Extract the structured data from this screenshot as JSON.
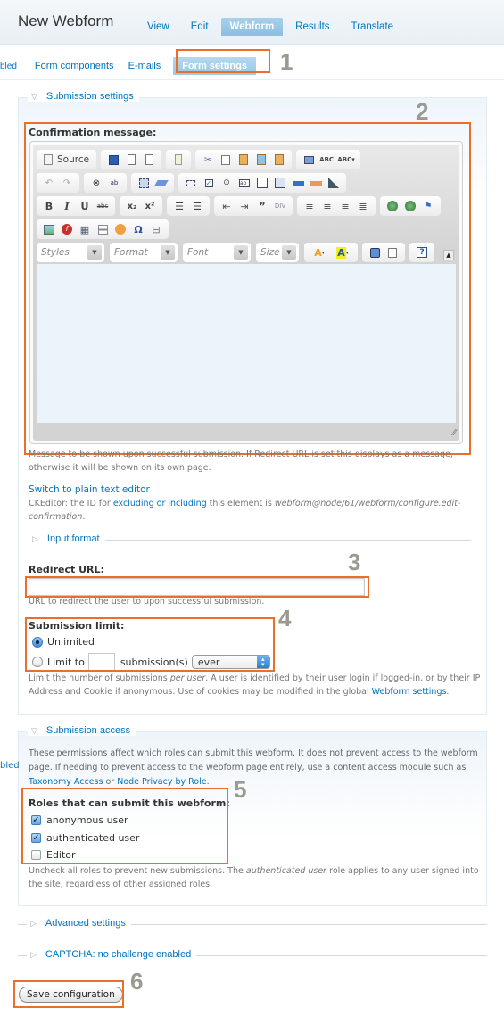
{
  "header": {
    "title": "New Webform",
    "tabs": [
      {
        "label": "View",
        "active": false
      },
      {
        "label": "Edit",
        "active": false
      },
      {
        "label": "Webform",
        "active": true
      },
      {
        "label": "Results",
        "active": false
      },
      {
        "label": "Translate",
        "active": false
      }
    ]
  },
  "subtabs": {
    "cut_label": "bled",
    "items": [
      {
        "label": "Form components",
        "active": false
      },
      {
        "label": "E-mails",
        "active": false
      },
      {
        "label": "Form settings",
        "active": true
      }
    ]
  },
  "callouts": [
    "1",
    "2",
    "3",
    "4",
    "5",
    "6"
  ],
  "submission_settings": {
    "legend": "Submission settings",
    "confirmation": {
      "label": "Confirmation message:",
      "toolbar": {
        "source_label": "Source",
        "combos": [
          "Styles",
          "Format",
          "Font",
          "Size"
        ]
      },
      "description": "Message to be shown upon successful submission. If Redirect URL is set this displays as a message, otherwise it will be shown on its own page.",
      "switch_link": "Switch to plain text editor",
      "cke_note_prefix": "CKEditor: the ID for",
      "cke_note_link": "excluding or including",
      "cke_note_middle": "this element is",
      "cke_note_id": "webform@node/61/webform/configure.edit-confirmation",
      "cke_note_end": "."
    },
    "input_format_legend": "Input format",
    "redirect": {
      "label": "Redirect URL:",
      "value": "",
      "description": "URL to redirect the user to upon successful submission."
    },
    "limit": {
      "label": "Submission limit:",
      "options": [
        {
          "label": "Unlimited",
          "selected": true
        },
        {
          "label": "Limit to",
          "selected": false
        }
      ],
      "count_value": "",
      "unit_label": "submission(s)",
      "period_value": "ever",
      "desc_1": "Limit the number of submissions",
      "desc_em": "per user",
      "desc_2": ". A user is identified by their user login if logged-in, or by their IP Address and Cookie if anonymous. Use of cookies may be modified in the global",
      "desc_link": "Webform settings",
      "desc_end": "."
    }
  },
  "submission_access": {
    "legend": "Submission access",
    "desc_1": "These permissions affect which roles can submit this webform. It does not prevent access to the webform page. If needing to prevent access to the webform page entirely, use a content access module such as",
    "link_1": "Taxonomy Access",
    "desc_or": "or",
    "link_2": "Node Privacy by Role",
    "desc_end": ".",
    "roles_label": "Roles that can submit this webform:",
    "roles": [
      {
        "label": "anonymous user",
        "checked": true
      },
      {
        "label": "authenticated user",
        "checked": true
      },
      {
        "label": "Editor",
        "checked": false
      }
    ],
    "roles_desc_1": "Uncheck all roles to prevent new submissions. The",
    "roles_desc_em": "authenticated user",
    "roles_desc_2": "role applies to any user signed into the site, regardless of other assigned roles.",
    "edge_text": "bled"
  },
  "advanced_legend": "Advanced settings",
  "captcha_legend": "CAPTCHA: no challenge enabled",
  "save_button": "Save configuration",
  "colors": {
    "link": "#0074bd",
    "callout": "#e8702a",
    "active_tab": "#8cbfe0"
  }
}
